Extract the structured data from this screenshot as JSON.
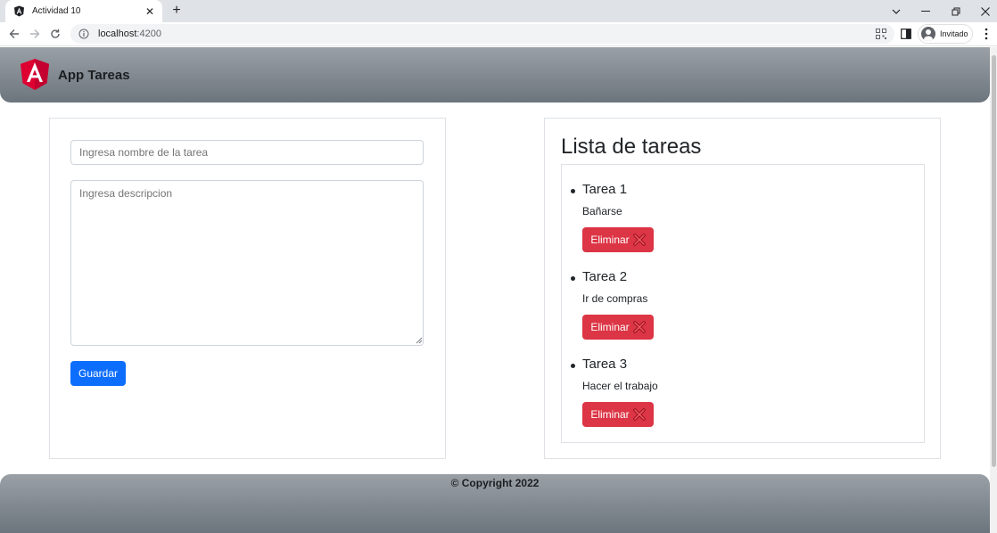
{
  "browser": {
    "tab_title": "Actividad 10",
    "url_host": "localhost",
    "url_port": ":4200",
    "profile_label": "Invitado"
  },
  "header": {
    "brand": "App Tareas"
  },
  "form": {
    "name_placeholder": "Ingresa nombre de la tarea",
    "desc_placeholder": "Ingresa descripcion",
    "save_label": "Guardar"
  },
  "list": {
    "title": "Lista de tareas",
    "delete_label": "Eliminar",
    "tasks": [
      {
        "title": "Tarea 1",
        "desc": "Bañarse"
      },
      {
        "title": "Tarea 2",
        "desc": "Ir de compras"
      },
      {
        "title": "Tarea 3",
        "desc": "Hacer el trabajo"
      }
    ]
  },
  "footer": {
    "copyright": "© Copyright 2022"
  },
  "colors": {
    "primary": "#0d6efd",
    "danger": "#dc3545",
    "angular_red": "#dd0031",
    "header_gray": "#6c757d"
  }
}
